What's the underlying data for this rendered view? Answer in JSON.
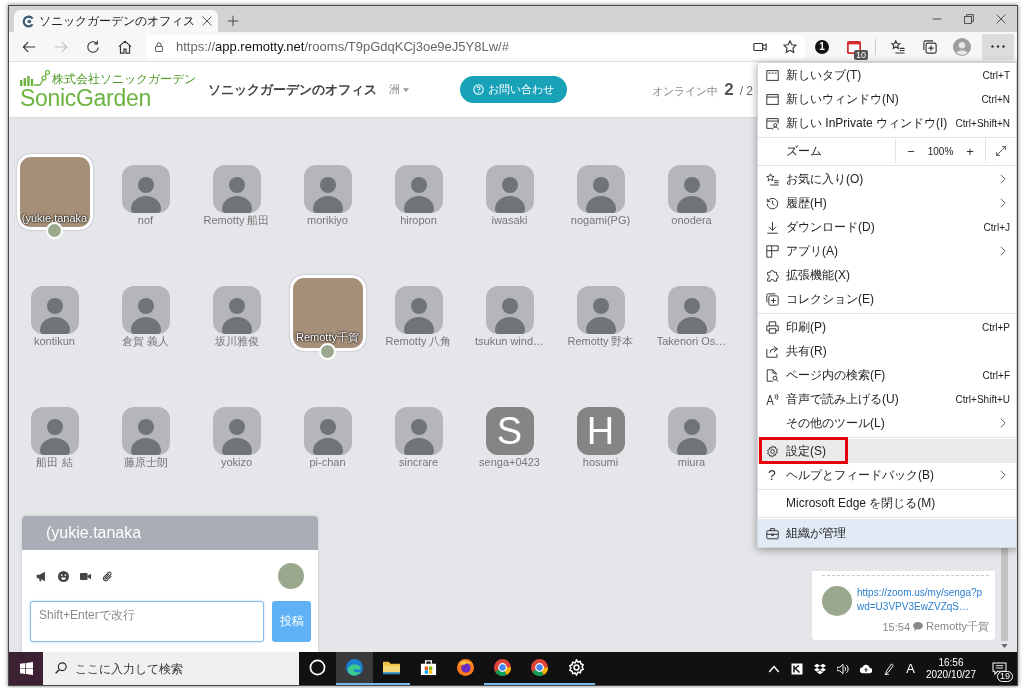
{
  "browser": {
    "tabs": [
      {
        "title": "ソニックガーデンのオフィス",
        "selected": true
      }
    ],
    "forward_disabled": true,
    "url": {
      "scheme": "https://",
      "host": "app.remotty.net",
      "path": "/rooms/T9pGdqKCj3oe9eJ5Y8Lw/#"
    },
    "extension_badge": "1",
    "calendar_badge": "10",
    "menu_open": true
  },
  "header": {
    "logo_company": "株式会社ソニックガーデン",
    "logo_name": "SonicGarden",
    "office_name": "ソニックガーデンのオフィス",
    "user_menu": "洲",
    "contact_button": "お問い合わせ",
    "online_label": "オンライン中",
    "online_count": "2",
    "online_total": "/ 2"
  },
  "members": [
    {
      "name": "(yukie.tanaka",
      "kind": "photo",
      "active": true
    },
    {
      "name": "nof",
      "kind": "photo",
      "active": false
    },
    {
      "name": "Remotty 船田",
      "kind": "photo",
      "active": false
    },
    {
      "name": "morikiyo",
      "kind": "photo",
      "active": false
    },
    {
      "name": "hiropon",
      "kind": "photo",
      "active": false
    },
    {
      "name": "iwasaki",
      "kind": "photo",
      "active": false
    },
    {
      "name": "nogami(PG)",
      "kind": "photo",
      "active": false
    },
    {
      "name": "onodera",
      "kind": "photo",
      "active": false
    },
    {
      "name": "kontikun",
      "kind": "photo",
      "active": false
    },
    {
      "name": "倉賀 義人",
      "kind": "photo",
      "active": false
    },
    {
      "name": "坂川雅俊",
      "kind": "photo",
      "active": false
    },
    {
      "name": "Remotty千賀",
      "kind": "photo",
      "active": true
    },
    {
      "name": "Remotty 八角",
      "kind": "photo",
      "active": false
    },
    {
      "name": "tsukun wind…",
      "kind": "photo",
      "active": false
    },
    {
      "name": "Remotty 野本",
      "kind": "photo",
      "active": false
    },
    {
      "name": "Takenori Os…",
      "kind": "photo",
      "active": false
    },
    {
      "name": "船田 結",
      "kind": "photo",
      "active": false
    },
    {
      "name": "藤原士朗",
      "kind": "photo",
      "active": false
    },
    {
      "name": "yokizo",
      "kind": "photo",
      "active": false
    },
    {
      "name": "pi-chan",
      "kind": "photo",
      "active": false
    },
    {
      "name": "sincrare",
      "kind": "photo",
      "active": false
    },
    {
      "name": "senga+0423",
      "kind": "letter",
      "letter": "S",
      "active": false
    },
    {
      "name": "hosumi",
      "kind": "letter",
      "letter": "H",
      "active": false
    },
    {
      "name": "miura",
      "kind": "photo",
      "active": false
    }
  ],
  "composer": {
    "title": "(yukie.tanaka",
    "placeholder": "Shift+Enterで改行",
    "submit": "投稿"
  },
  "timeline": {
    "messages": [
      {
        "link": "https://zoom.us/my/senga?pwd=U3VPV3EwZVZqS…",
        "time": "15:54",
        "author": "Remotty千賀"
      }
    ]
  },
  "menu": {
    "groups": [
      [
        {
          "kind": "item",
          "label": "新しいタブ(T)",
          "shortcut": "Ctrl+T",
          "submenu": false,
          "highlighted": false,
          "annotated": false
        },
        {
          "kind": "item",
          "label": "新しいウィンドウ(N)",
          "shortcut": "Ctrl+N",
          "submenu": false,
          "highlighted": false,
          "annotated": false
        },
        {
          "kind": "item",
          "label": "新しい InPrivate ウィンドウ(I)",
          "shortcut": "Ctrl+Shift+N",
          "submenu": false,
          "highlighted": false,
          "annotated": false
        }
      ],
      [
        {
          "kind": "zoom",
          "label": "ズーム",
          "zoom_out": "−",
          "value": "100%",
          "zoom_in": "+"
        }
      ],
      [
        {
          "kind": "item",
          "label": "お気に入り(O)",
          "submenu": true,
          "highlighted": false,
          "annotated": false
        },
        {
          "kind": "item",
          "label": "履歴(H)",
          "submenu": true,
          "highlighted": false,
          "annotated": false
        },
        {
          "kind": "item",
          "label": "ダウンロード(D)",
          "shortcut": "Ctrl+J",
          "submenu": false,
          "highlighted": false,
          "annotated": false
        },
        {
          "kind": "item",
          "label": "アプリ(A)",
          "submenu": true,
          "highlighted": false,
          "annotated": false
        },
        {
          "kind": "item",
          "label": "拡張機能(X)",
          "submenu": false,
          "highlighted": false,
          "annotated": false
        },
        {
          "kind": "item",
          "label": "コレクション(E)",
          "submenu": false,
          "highlighted": false,
          "annotated": false
        }
      ],
      [
        {
          "kind": "item",
          "label": "印刷(P)",
          "shortcut": "Ctrl+P",
          "submenu": false,
          "highlighted": false,
          "annotated": false
        },
        {
          "kind": "item",
          "label": "共有(R)",
          "submenu": false,
          "highlighted": false,
          "annotated": false
        },
        {
          "kind": "item",
          "label": "ページ内の検索(F)",
          "shortcut": "Ctrl+F",
          "submenu": false,
          "highlighted": false,
          "annotated": false
        },
        {
          "kind": "item",
          "label": "音声で読み上げる(U)",
          "shortcut": "Ctrl+Shift+U",
          "submenu": false,
          "highlighted": false,
          "annotated": false
        },
        {
          "kind": "item",
          "label": "その他のツール(L)",
          "submenu": true,
          "highlighted": false,
          "annotated": false
        }
      ],
      [
        {
          "kind": "item",
          "label": "設定(S)",
          "submenu": false,
          "highlighted": true,
          "annotated": true
        },
        {
          "kind": "item",
          "label": "ヘルプとフィードバック(B)",
          "glyph": "?",
          "submenu": true,
          "highlighted": false,
          "annotated": false
        }
      ],
      [
        {
          "kind": "item",
          "label": "Microsoft Edge を閉じる(M)",
          "submenu": false,
          "highlighted": false,
          "annotated": false
        }
      ],
      [
        {
          "kind": "managed",
          "label": "組織が管理"
        }
      ]
    ]
  },
  "taskbar": {
    "search": {
      "placeholder": "ここに入力して検索"
    },
    "apps": [
      {
        "running": false,
        "selected": false
      },
      {
        "running": true,
        "selected": true
      },
      {
        "running": true,
        "selected": false
      },
      {
        "running": false,
        "selected": false
      },
      {
        "running": false,
        "selected": false
      },
      {
        "running": true,
        "selected": false
      },
      {
        "running": true,
        "selected": false
      },
      {
        "running": true,
        "selected": false
      }
    ],
    "ime": "A",
    "time": "16:56",
    "date": "2020/10/27",
    "notifications": "19"
  }
}
